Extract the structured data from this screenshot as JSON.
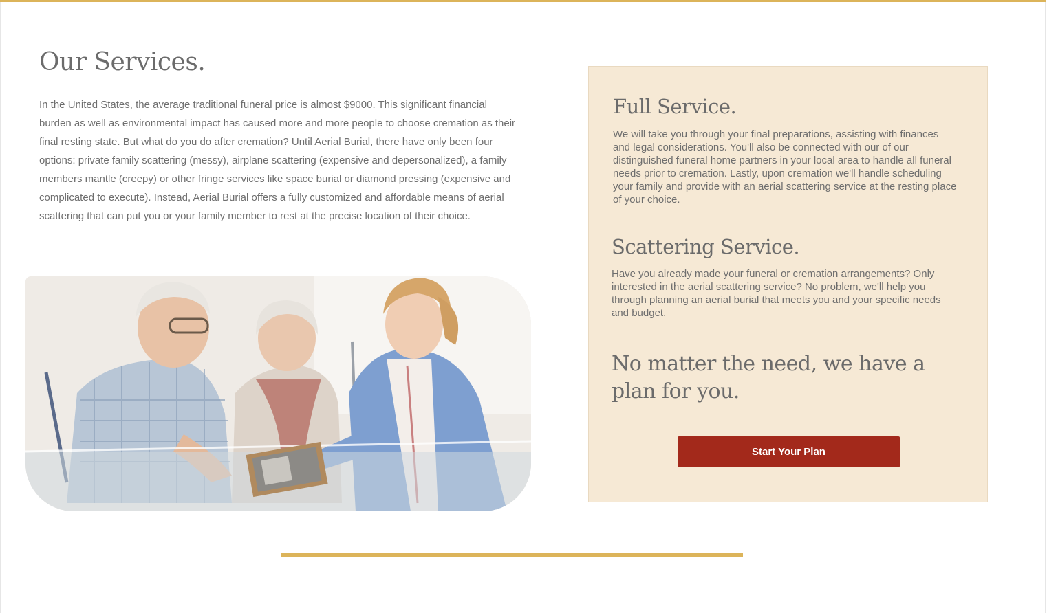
{
  "services": {
    "title": "Our Services.",
    "intro": "In the United States, the average traditional funeral price is almost $9000. This significant financial burden as well as environmental impact has caused more and more people to choose cremation as their final resting state. But what do you do after cremation? Until Aerial Burial, there have only been four options: private family scattering (messy), airplane scattering (expensive and depersonalized), a family members mantle (creepy) or other fringe services like space burial or diamond pressing (expensive and complicated to execute). Instead,  Aerial Burial offers a fully customized and affordable means of aerial scattering that can put you or your family member to rest at the precise location of their choice."
  },
  "panel": {
    "full_service": {
      "title": "Full Service.",
      "text": "We will take you through your final preparations, assisting with finances and legal considerations. You'll also be connected with our of our distinguished funeral home partners in your local area to handle all funeral needs prior to cremation. Lastly, upon cremation we'll handle scheduling your family and provide with an aerial scattering service at the resting place of your choice."
    },
    "scattering_service": {
      "title": "Scattering Service.",
      "text": "Have you already made your funeral or cremation arrangements? Only interested in the aerial scattering service? No problem, we'll help you through planning an aerial burial that meets you and your specific needs and budget."
    },
    "tagline": "No matter the need, we have a plan for you.",
    "cta_label": "Start Your Plan"
  },
  "colors": {
    "accent_gold": "#dcb45a",
    "panel_bg": "#f6e9d5",
    "cta_red": "#a3291b",
    "text_gray": "#6e6e6e"
  }
}
